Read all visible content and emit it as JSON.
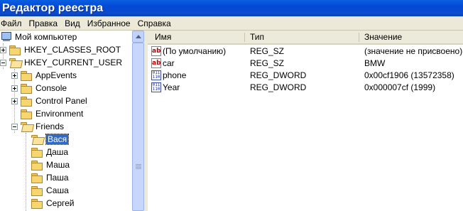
{
  "window": {
    "title": "Редактор реестра"
  },
  "menu": [
    "Файл",
    "Правка",
    "Вид",
    "Избранное",
    "Справка"
  ],
  "tree": {
    "root": "Мой компьютер",
    "hives": [
      "HKEY_CLASSES_ROOT",
      "HKEY_CURRENT_USER"
    ],
    "hkcu_children": [
      "AppEvents",
      "Console",
      "Control Panel",
      "Environment",
      "Friends"
    ],
    "friends_children": [
      "Вася",
      "Даша",
      "Маша",
      "Паша",
      "Саша",
      "Сергей"
    ],
    "selected": "Вася"
  },
  "list": {
    "columns": [
      "Имя",
      "Тип",
      "Значение"
    ],
    "rows": [
      {
        "icon": "string-value-icon",
        "name": "(По умолчанию)",
        "type": "REG_SZ",
        "value": "(значение не присвоено)"
      },
      {
        "icon": "string-value-icon",
        "name": "car",
        "type": "REG_SZ",
        "value": "BMW"
      },
      {
        "icon": "binary-value-icon",
        "name": "phone",
        "type": "REG_DWORD",
        "value": "0x00cf1906 (13572358)"
      },
      {
        "icon": "binary-value-icon",
        "name": "Year",
        "type": "REG_DWORD",
        "value": "0x000007cf (1999)"
      }
    ]
  },
  "colors": {
    "titlebar": "#0348d6",
    "selection": "#316ac5",
    "chrome": "#ece9d8"
  }
}
